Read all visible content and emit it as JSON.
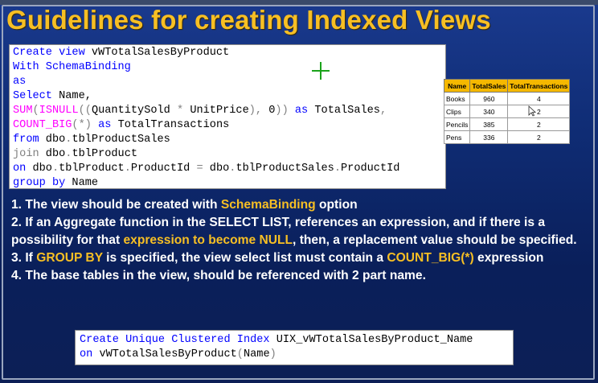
{
  "window": {
    "title_fragment": "…"
  },
  "slide": {
    "title": "Guidelines for creating Indexed Views",
    "code1": {
      "l1_kw": "Create view",
      "l1_name": " vWTotalSalesByProduct",
      "l2_kw": "With SchemaBinding",
      "l3_kw": "as",
      "l4_kw": "Select",
      "l4_rest": " Name,",
      "l5_fn1": "SUM",
      "l5_p1": "(",
      "l5_fn2": "ISNULL",
      "l5_p2": "((",
      "l5_mid": "QuantitySold ",
      "l5_op1": "*",
      "l5_mid2": " UnitPrice",
      "l5_p3": "),",
      "l5_zero": " 0",
      "l5_p4": "))",
      "l5_as": " as",
      "l5_alias": " TotalSales",
      "l5_comma": ",",
      "l6_fn": "COUNT_BIG",
      "l6_p1": "(",
      "l6_star": "*",
      "l6_p2": ")",
      "l6_as": " as",
      "l6_alias": " TotalTransactions",
      "l7_kw": "from",
      "l7_rest": " dbo",
      "l7_dot": ".",
      "l7_tbl": "tblProductSales",
      "l8_kw": "join",
      "l8_rest": " dbo",
      "l8_dot": ".",
      "l8_tbl": "tblProduct",
      "l9_kw": "on",
      "l9_a": " dbo",
      "l9_d1": ".",
      "l9_b": "tblProduct",
      "l9_d2": ".",
      "l9_c": "ProductId ",
      "l9_eq": "=",
      "l9_d": " dbo",
      "l9_d3": ".",
      "l9_e": "tblProductSales",
      "l9_d4": ".",
      "l9_f": "ProductId",
      "l10_kw": "group by",
      "l10_rest": " Name"
    },
    "result_table": {
      "headers": [
        "Name",
        "TotalSales",
        "TotalTransactions"
      ],
      "rows": [
        [
          "Books",
          "960",
          "4"
        ],
        [
          "Clips",
          "340",
          "2"
        ],
        [
          "Pencils",
          "385",
          "2"
        ],
        [
          "Pens",
          "336",
          "2"
        ]
      ]
    },
    "bullets": {
      "b1_pre": "1. The view should be created with ",
      "b1_hl": "SchemaBinding",
      "b1_post": " option",
      "b2_pre": "2. If an Aggregate function in the SELECT LIST, references an expression, and if there is a possibility for that ",
      "b2_hl": "expression to become NULL",
      "b2_post": ", then, a replacement value should be specified.",
      "b3_pre": "3. If ",
      "b3_hl1": "GROUP BY",
      "b3_mid": " is specified, the view select list must contain a ",
      "b3_hl2": "COUNT_BIG(*)",
      "b3_post": " expression",
      "b4": "4. The base tables in the view, should be referenced with 2 part name."
    },
    "code2": {
      "l1_kw": "Create Unique Clustered Index",
      "l1_name": " UIX_vWTotalSalesByProduct_Name",
      "l2_kw": "on",
      "l2_name": " vWTotalSalesByProduct",
      "l2_p1": "(",
      "l2_col": "Name",
      "l2_p2": ")"
    }
  },
  "colors": {
    "title": "#f7bf24",
    "highlight": "#f7bf24",
    "keyword": "#0000ff",
    "function": "#ff00ff",
    "operator": "#808080",
    "table_header": "#f5b800"
  }
}
